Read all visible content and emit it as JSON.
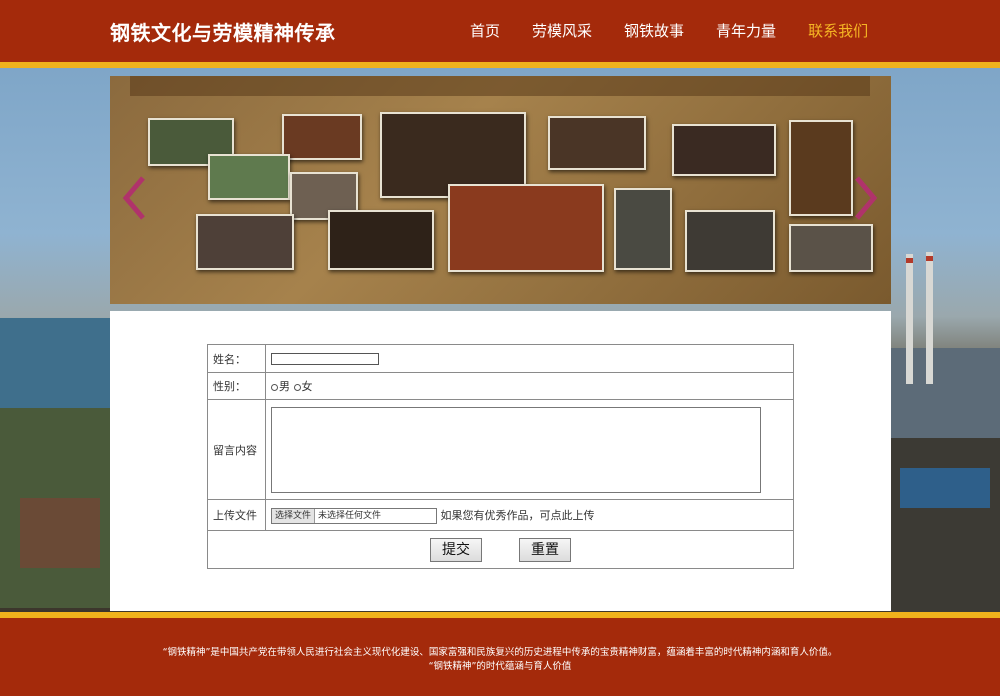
{
  "header": {
    "site_title": "钢铁文化与劳模精神传承",
    "nav": [
      {
        "label": "首页"
      },
      {
        "label": "劳模风采"
      },
      {
        "label": "钢铁故事"
      },
      {
        "label": "青年力量"
      },
      {
        "label": "联系我们",
        "active": true
      }
    ]
  },
  "colors": {
    "header_bg": "#a42a0b",
    "accent_strip": "#f0b21c",
    "active_nav": "#f5b524"
  },
  "banner": {
    "prev_icon": "chevron-left-icon",
    "next_icon": "chevron-right-icon"
  },
  "form": {
    "name_label": "姓名：",
    "gender_label": "性别：",
    "gender_options": [
      "男",
      "女"
    ],
    "message_label": "留言内容",
    "upload_label": "上传文件",
    "file_button": "选择文件",
    "file_status": "未选择任何文件",
    "upload_hint": "如果您有优秀作品，可点此上传",
    "submit_label": "提交",
    "reset_label": "重置"
  },
  "footer": {
    "line1": "“钢铁精神”是中国共产党在带领人民进行社会主义现代化建设、国家富强和民族复兴的历史进程中传承的宝贵精神财富，蕴涵着丰富的时代精神内涵和育人价值。",
    "line2": "“钢铁精神”的时代蕴涵与育人价值"
  }
}
